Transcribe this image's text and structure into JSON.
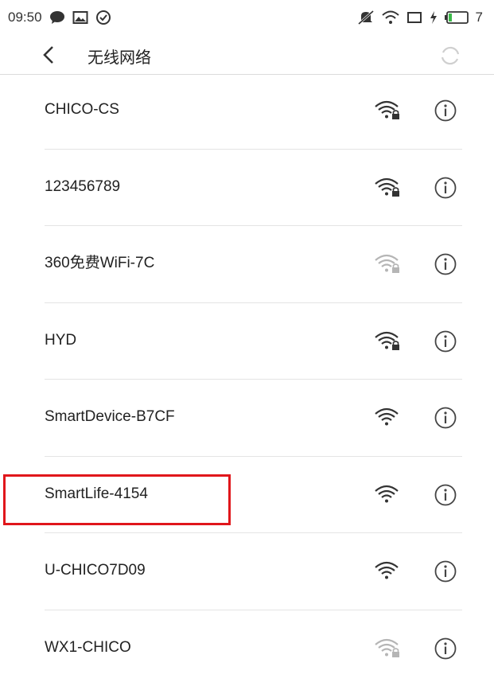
{
  "status_bar": {
    "time": "09:50",
    "battery_level": "7",
    "icons": [
      "chat-bubble-icon",
      "image-icon",
      "check-circle-icon",
      "mute-icon",
      "wifi-status-icon",
      "sim-card-icon",
      "charging-icon",
      "battery-icon"
    ]
  },
  "header": {
    "title": "无线网络",
    "back_icon": "chevron-left-icon",
    "refresh_icon": "refresh-icon"
  },
  "networks": [
    {
      "name": "CHICO-CS",
      "secured": true,
      "signal": "strong"
    },
    {
      "name": "123456789",
      "secured": true,
      "signal": "strong"
    },
    {
      "name": "360免费WiFi-7C",
      "secured": true,
      "signal": "weak"
    },
    {
      "name": "HYD",
      "secured": true,
      "signal": "strong"
    },
    {
      "name": "SmartDevice-B7CF",
      "secured": false,
      "signal": "strong"
    },
    {
      "name": "SmartLife-4154",
      "secured": false,
      "signal": "strong",
      "highlighted": true
    },
    {
      "name": "U-CHICO7D09",
      "secured": false,
      "signal": "strong"
    },
    {
      "name": "WX1-CHICO",
      "secured": true,
      "signal": "weak"
    }
  ],
  "colors": {
    "highlight": "#e0161b",
    "icon_strong": "#333333",
    "icon_weak": "#b5b5b5"
  }
}
